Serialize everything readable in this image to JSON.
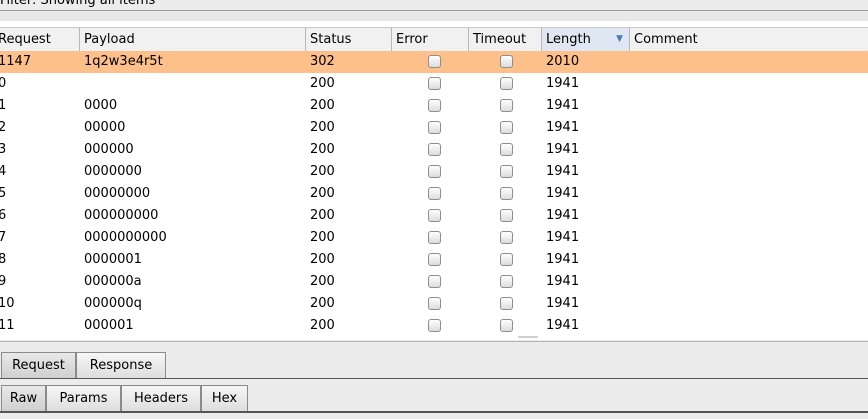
{
  "filter": {
    "text": "Filter: Showing all items"
  },
  "columns": [
    "Request",
    "Payload",
    "Status",
    "Error",
    "Timeout",
    "Length",
    "Comment"
  ],
  "sort_indicator": "▼",
  "rows": [
    {
      "request": "1147",
      "payload": "1q2w3e4r5t",
      "status": "302",
      "error": false,
      "timeout": false,
      "length": "2010",
      "comment": "",
      "selected": true
    },
    {
      "request": "0",
      "payload": "",
      "status": "200",
      "error": false,
      "timeout": false,
      "length": "1941",
      "comment": ""
    },
    {
      "request": "1",
      "payload": "0000",
      "status": "200",
      "error": false,
      "timeout": false,
      "length": "1941",
      "comment": ""
    },
    {
      "request": "2",
      "payload": "00000",
      "status": "200",
      "error": false,
      "timeout": false,
      "length": "1941",
      "comment": ""
    },
    {
      "request": "3",
      "payload": "000000",
      "status": "200",
      "error": false,
      "timeout": false,
      "length": "1941",
      "comment": ""
    },
    {
      "request": "4",
      "payload": "0000000",
      "status": "200",
      "error": false,
      "timeout": false,
      "length": "1941",
      "comment": ""
    },
    {
      "request": "5",
      "payload": "00000000",
      "status": "200",
      "error": false,
      "timeout": false,
      "length": "1941",
      "comment": ""
    },
    {
      "request": "6",
      "payload": "000000000",
      "status": "200",
      "error": false,
      "timeout": false,
      "length": "1941",
      "comment": ""
    },
    {
      "request": "7",
      "payload": "0000000000",
      "status": "200",
      "error": false,
      "timeout": false,
      "length": "1941",
      "comment": ""
    },
    {
      "request": "8",
      "payload": "0000001",
      "status": "200",
      "error": false,
      "timeout": false,
      "length": "1941",
      "comment": ""
    },
    {
      "request": "9",
      "payload": "000000a",
      "status": "200",
      "error": false,
      "timeout": false,
      "length": "1941",
      "comment": ""
    },
    {
      "request": "10",
      "payload": "000000q",
      "status": "200",
      "error": false,
      "timeout": false,
      "length": "1941",
      "comment": ""
    },
    {
      "request": "11",
      "payload": "000001",
      "status": "200",
      "error": false,
      "timeout": false,
      "length": "1941",
      "comment": ""
    }
  ],
  "message_tabs": [
    "Request",
    "Response"
  ],
  "view_tabs": [
    "Raw",
    "Params",
    "Headers",
    "Hex"
  ],
  "colors": {
    "selected_row": "#fdc08a",
    "sort_icon": "#4a7ab5"
  }
}
